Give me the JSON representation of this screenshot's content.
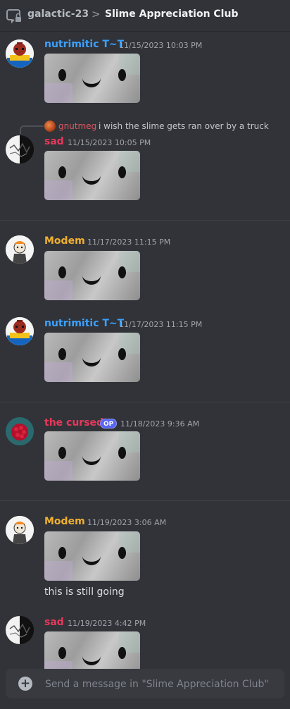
{
  "header": {
    "channel": "galactic-23",
    "separator": ">",
    "thread_title": "Slime Appreciation Club"
  },
  "messages": [
    {
      "author": "nutrimitic T~T",
      "timestamp": "11/15/2023 10:03 PM",
      "color": "#3ba1ff"
    },
    {
      "author": "sad",
      "timestamp": "11/15/2023 10:05 PM",
      "color": "#e8385b",
      "reply": {
        "author": "gnutmeg",
        "text": "i wish the slime gets ran over by a truck",
        "color": "#e0555e"
      }
    },
    {
      "author": "Modem",
      "timestamp": "11/17/2023 11:15 PM",
      "color": "#f0b132"
    },
    {
      "author": "nutrimitic T~T",
      "timestamp": "11/17/2023 11:15 PM",
      "color": "#3ba1ff"
    },
    {
      "author": "the cursed",
      "badge": "OP",
      "timestamp": "11/18/2023 9:36 AM",
      "color": "#e8385b"
    },
    {
      "author": "Modem",
      "timestamp": "11/19/2023 3:06 AM",
      "color": "#f0b132",
      "text": "this is still going"
    },
    {
      "author": "sad",
      "timestamp": "11/19/2023 4:42 PM",
      "color": "#e8385b"
    }
  ],
  "composer": {
    "placeholder": "Send a message in \"Slime Appreciation Club\""
  },
  "icons": {
    "thread": "thread-icon",
    "add": "plus-circle-icon"
  }
}
